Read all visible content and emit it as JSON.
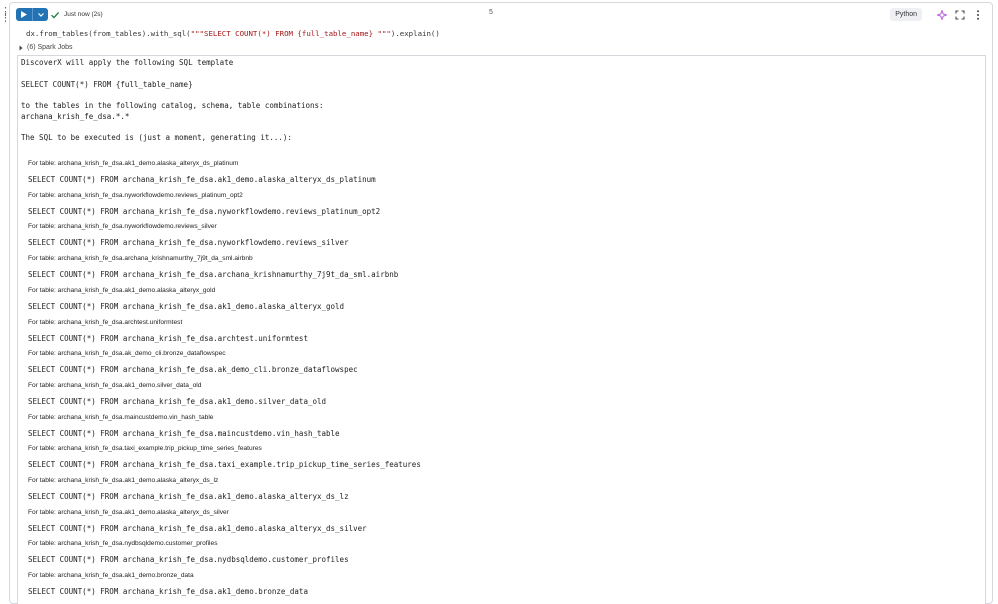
{
  "left_margin": {
    "dots": "⋮"
  },
  "toolbar": {
    "status": "Just now (2s)",
    "cell_number": "5",
    "language": "Python",
    "icons": [
      "play-icon",
      "chevron-down-icon",
      "check-icon",
      "assistant-icon",
      "expand-icon",
      "more-vert-icon"
    ]
  },
  "code": {
    "prefix": "dx.from_tables(from_tables).with_sql(",
    "string": "\"\"\"SELECT COUNT(*) FROM {full_table_name} \"\"\"",
    "suffix": ").explain()"
  },
  "spark_jobs": "(6) Spark Jobs",
  "output": {
    "intro_lines": [
      "DiscoverX will apply the following SQL template",
      "",
      "SELECT COUNT(*) FROM {full_table_name}",
      "",
      "to the tables in the following catalog, schema, table combinations:",
      "archana_krish_fe_dsa.*.*",
      "",
      "The SQL to be executed is (just a moment, generating it...):"
    ],
    "pairs": [
      {
        "label": "For table: archana_krish_fe_dsa.ak1_demo.alaska_alteryx_ds_platinum",
        "sql": "SELECT COUNT(*) FROM archana_krish_fe_dsa.ak1_demo.alaska_alteryx_ds_platinum"
      },
      {
        "label": "For table: archana_krish_fe_dsa.nyworkflowdemo.reviews_platinum_opt2",
        "sql": "SELECT COUNT(*) FROM archana_krish_fe_dsa.nyworkflowdemo.reviews_platinum_opt2"
      },
      {
        "label": "For table: archana_krish_fe_dsa.nyworkflowdemo.reviews_silver",
        "sql": "SELECT COUNT(*) FROM archana_krish_fe_dsa.nyworkflowdemo.reviews_silver"
      },
      {
        "label": "For table: archana_krish_fe_dsa.archana_krishnamurthy_7j9t_da_sml.airbnb",
        "sql": "SELECT COUNT(*) FROM archana_krish_fe_dsa.archana_krishnamurthy_7j9t_da_sml.airbnb"
      },
      {
        "label": "For table: archana_krish_fe_dsa.ak1_demo.alaska_alteryx_gold",
        "sql": "SELECT COUNT(*) FROM archana_krish_fe_dsa.ak1_demo.alaska_alteryx_gold"
      },
      {
        "label": "For table: archana_krish_fe_dsa.archtest.uniformtest",
        "sql": "SELECT COUNT(*) FROM archana_krish_fe_dsa.archtest.uniformtest"
      },
      {
        "label": "For table: archana_krish_fe_dsa.ak_demo_cli.bronze_dataflowspec",
        "sql": "SELECT COUNT(*) FROM archana_krish_fe_dsa.ak_demo_cli.bronze_dataflowspec"
      },
      {
        "label": "For table: archana_krish_fe_dsa.ak1_demo.silver_data_old",
        "sql": "SELECT COUNT(*) FROM archana_krish_fe_dsa.ak1_demo.silver_data_old"
      },
      {
        "label": "For table: archana_krish_fe_dsa.maincustdemo.vin_hash_table",
        "sql": "SELECT COUNT(*) FROM archana_krish_fe_dsa.maincustdemo.vin_hash_table"
      },
      {
        "label": "For table: archana_krish_fe_dsa.taxi_example.trip_pickup_time_series_features",
        "sql": "SELECT COUNT(*) FROM archana_krish_fe_dsa.taxi_example.trip_pickup_time_series_features"
      },
      {
        "label": "For table: archana_krish_fe_dsa.ak1_demo.alaska_alteryx_ds_lz",
        "sql": "SELECT COUNT(*) FROM archana_krish_fe_dsa.ak1_demo.alaska_alteryx_ds_lz"
      },
      {
        "label": "For table: archana_krish_fe_dsa.ak1_demo.alaska_alteryx_ds_silver",
        "sql": "SELECT COUNT(*) FROM archana_krish_fe_dsa.ak1_demo.alaska_alteryx_ds_silver"
      },
      {
        "label": "For table: archana_krish_fe_dsa.nydbsqldemo.customer_profiles",
        "sql": "SELECT COUNT(*) FROM archana_krish_fe_dsa.nydbsqldemo.customer_profiles"
      },
      {
        "label": "For table: archana_krish_fe_dsa.ak1_demo.bronze_data",
        "sql": "SELECT COUNT(*) FROM archana_krish_fe_dsa.ak1_demo.bronze_data"
      }
    ]
  },
  "colors": {
    "run_button": "#2272b4",
    "assistant_icon": "#b45fd6",
    "string_literal": "#a31515",
    "border": "#d5d9de"
  }
}
